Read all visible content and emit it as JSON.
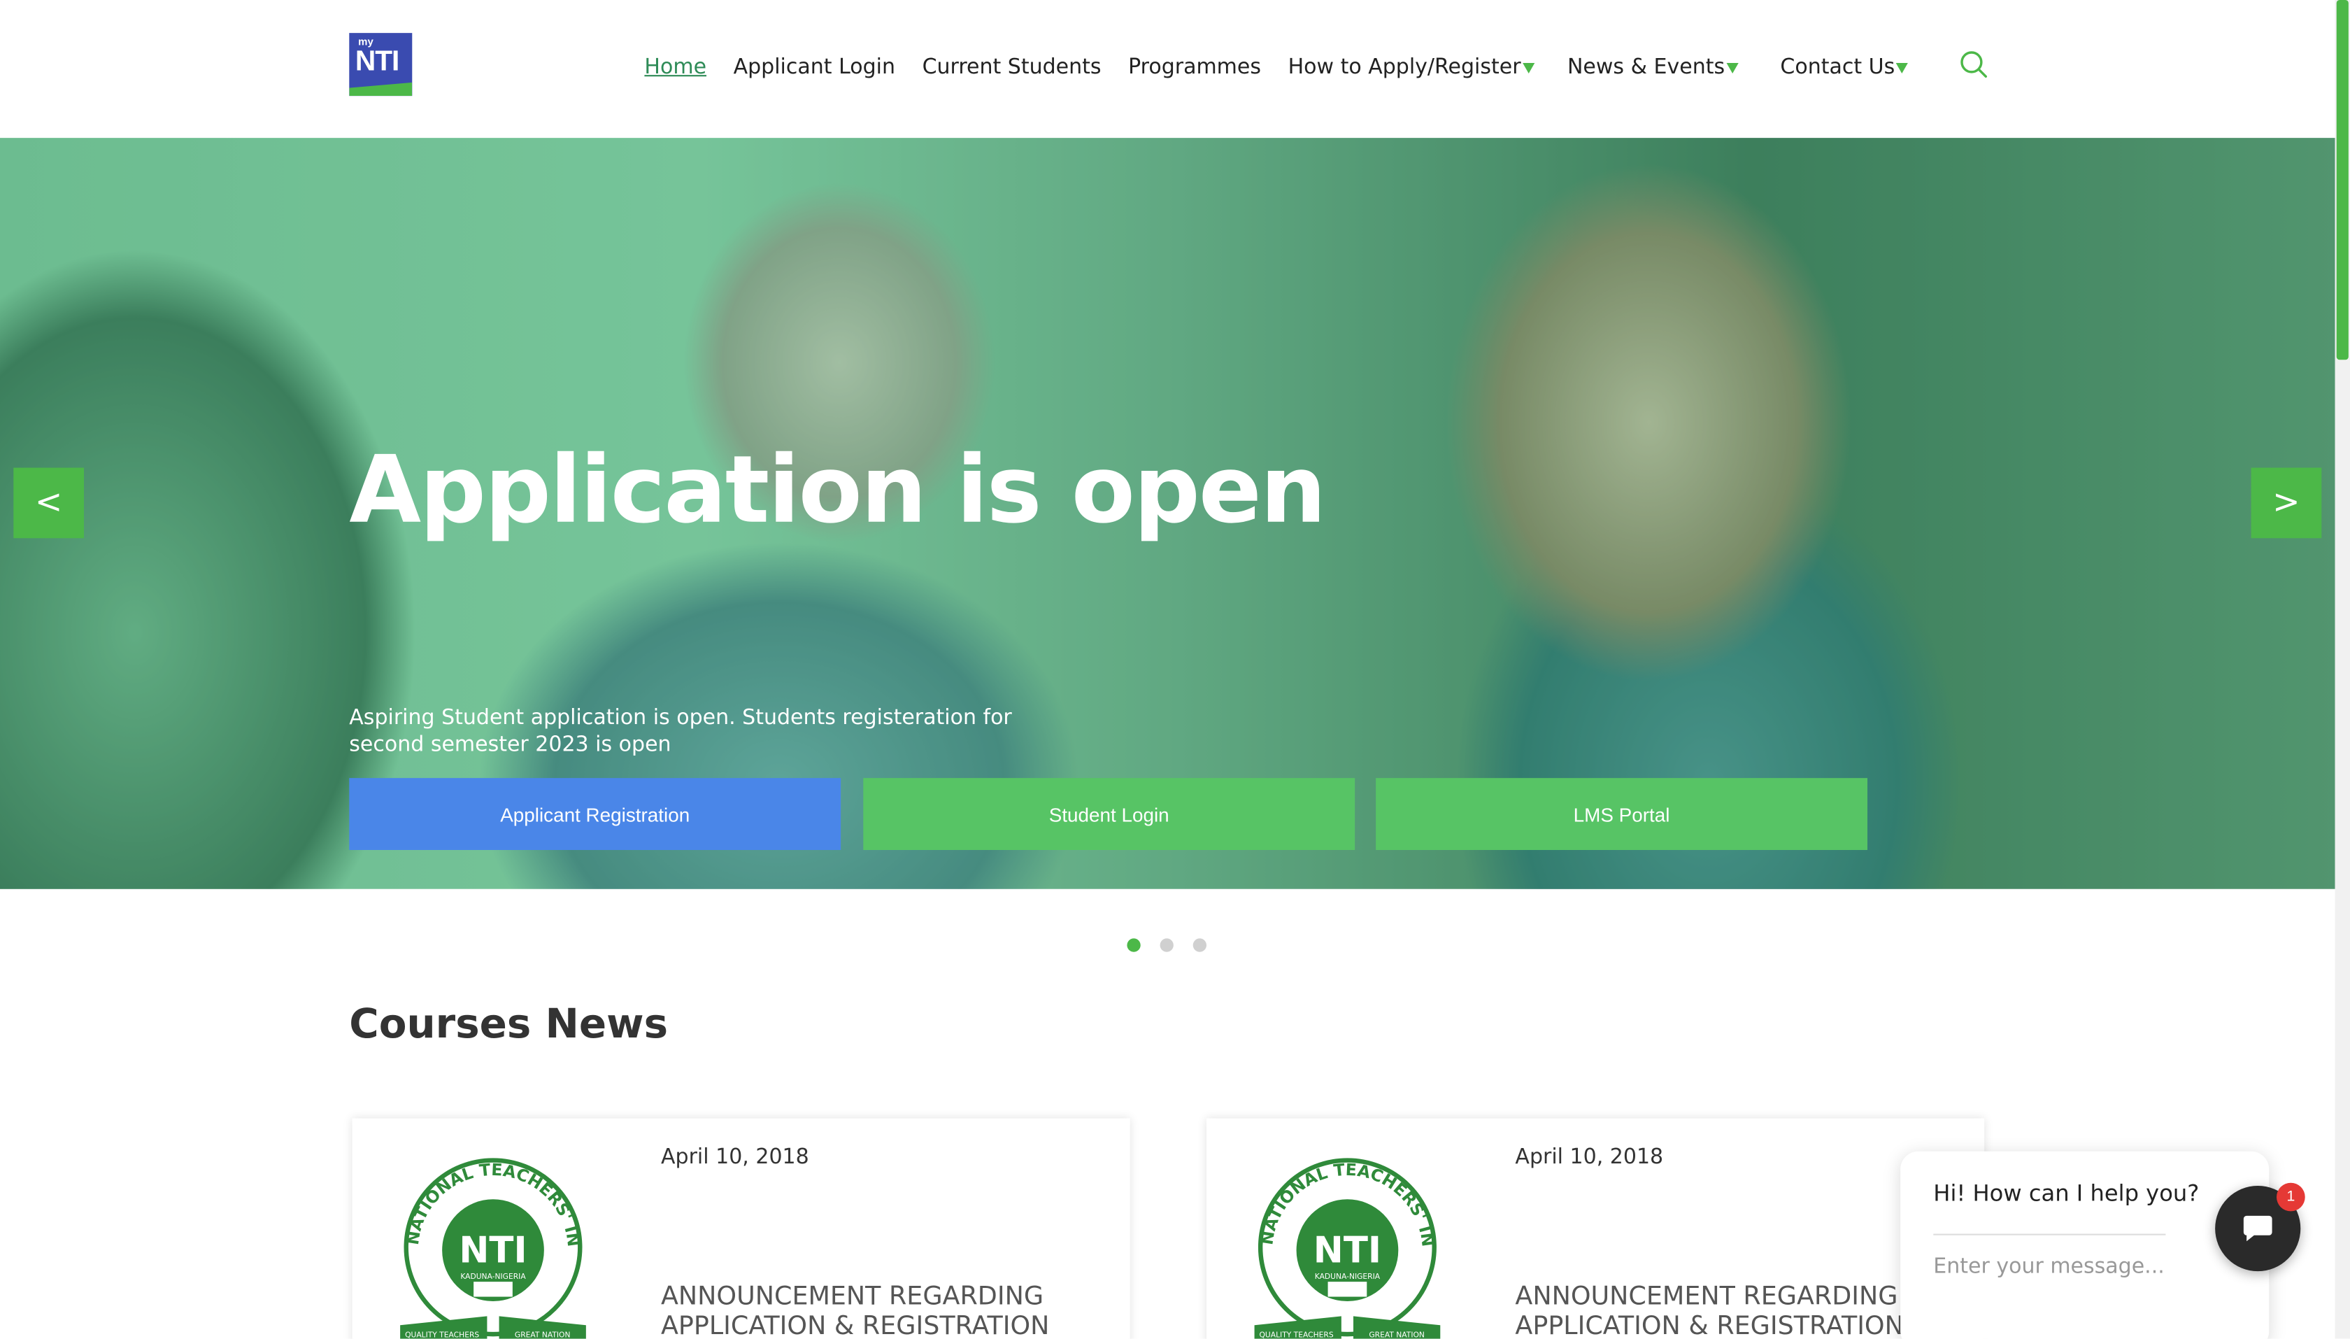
{
  "logo": {
    "small_text": "my",
    "main_text": "NTI",
    "icon": "nti-logo"
  },
  "nav": {
    "items": [
      {
        "label": "Home",
        "active": true,
        "dropdown": false
      },
      {
        "label": "Applicant Login",
        "active": false,
        "dropdown": false
      },
      {
        "label": "Current Students",
        "active": false,
        "dropdown": false
      },
      {
        "label": "Programmes",
        "active": false,
        "dropdown": false
      },
      {
        "label": "How to Apply/Register",
        "active": false,
        "dropdown": true
      },
      {
        "label": "News & Events",
        "active": false,
        "dropdown": true
      },
      {
        "label": "Contact Us",
        "active": false,
        "dropdown": true
      }
    ],
    "search_icon": "search-icon"
  },
  "hero": {
    "title": "Application is open",
    "description": "Aspiring Student application is open. Students registeration for second semester 2023 is open",
    "buttons": {
      "applicant_registration": "Applicant Registration",
      "student_login": "Student Login",
      "lms_portal": "LMS Portal"
    },
    "prev_label": "<",
    "next_label": ">",
    "slide_count": 3,
    "active_slide": 1
  },
  "section": {
    "title": "Courses News"
  },
  "cards": [
    {
      "date": "April 10, 2018",
      "heading": "ANNOUNCEMENT REGARDING APPLICATION & REGISTRATION"
    },
    {
      "date": "April 10, 2018",
      "heading": "ANNOUNCEMENT REGARDING APPLICATION & REGISTRATION"
    }
  ],
  "seal": {
    "ring_text": "NATIONAL TEACHERS' INSTITUTE",
    "center_text": "NTI",
    "sub_text": "KADUNA-NIGERIA",
    "ribbon_left": "QUALITY TEACHERS",
    "ribbon_right": "GREAT NATION"
  },
  "chat": {
    "greeting": "Hi! How can I help you?",
    "placeholder": "Enter your message...",
    "badge_count": "1"
  },
  "colors": {
    "accent_green": "#4cb848",
    "button_blue": "#4a86e8",
    "button_green": "#57c465",
    "logo_blue": "#3a4bb0",
    "badge_red": "#e53935"
  }
}
